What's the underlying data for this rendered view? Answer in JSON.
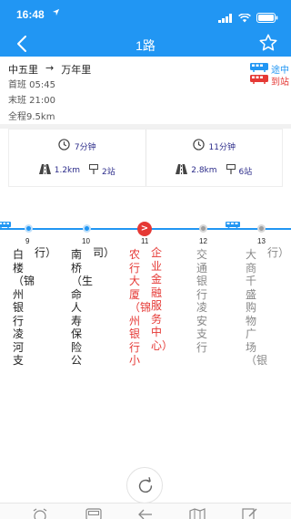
{
  "status_bar": {
    "time": "16:48",
    "location_icon": "location-arrow-icon",
    "signal_icon": "signal-bars-icon",
    "wifi_icon": "wifi-icon",
    "battery_icon": "battery-icon"
  },
  "nav": {
    "title": "1路",
    "back_icon": "chevron-left-icon",
    "favorite_icon": "star-outline-icon"
  },
  "route": {
    "start": "中五里",
    "arrow": "→",
    "end": "万年里",
    "first_bus": "首班 05:45",
    "last_bus": "末班 21:00",
    "total_distance": "全程9.5km",
    "legend_en_route": "途中",
    "legend_arrived": "到站",
    "colors": {
      "en_route": "#2196f3",
      "arrived": "#e53935"
    }
  },
  "eta": [
    {
      "time": "7分钟",
      "distance": "1.2km",
      "stops": "2站"
    },
    {
      "time": "11分钟",
      "distance": "2.8km",
      "stops": "6站"
    }
  ],
  "stations": [
    {
      "tail": "行）",
      "num": "9",
      "name": "白楼（锦州银行凌河支",
      "state": "passed"
    },
    {
      "tail": "司）",
      "num": "10",
      "name": "南桥（生命人寿保险公",
      "state": "passed"
    },
    {
      "tail": "企业金融服务中心）",
      "num": "11",
      "name": "农行大厦（锦州银行小",
      "state": "current"
    },
    {
      "tail": "",
      "num": "12",
      "name": "交通银行凌安支行",
      "state": "upcoming"
    },
    {
      "tail": "行）",
      "num": "13",
      "name": "大商千盛购物广场（银",
      "state": "upcoming"
    }
  ],
  "refresh_icon": "refresh-icon",
  "current_marker": ">",
  "bottom_tabs": [
    "alarm-clock-icon",
    "bus-icon",
    "transfer-icon",
    "map-icon",
    "edit-icon"
  ]
}
